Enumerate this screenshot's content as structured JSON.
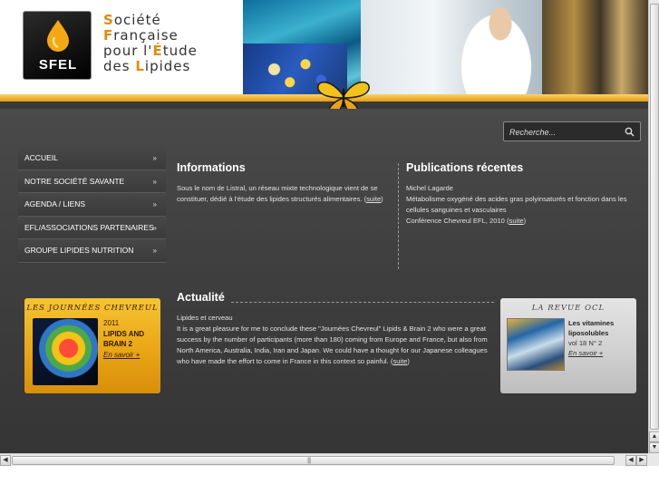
{
  "header": {
    "logo_text": "SFEL",
    "society_name_lines": [
      {
        "cap": "S",
        "rest": "ociété"
      },
      {
        "cap": "F",
        "rest": "rançaise"
      },
      {
        "pre": "pour l'",
        "cap": "É",
        "rest": "tude"
      },
      {
        "pre": "des ",
        "cap": "L",
        "rest": "ipides"
      }
    ]
  },
  "search": {
    "placeholder": "Recherche..."
  },
  "nav": {
    "items": [
      {
        "label": "ACCUEIL",
        "arrow": "»"
      },
      {
        "label": "NOTRE SOCIÉTÉ SAVANTE",
        "arrow": "»"
      },
      {
        "label": "AGENDA / LIENS",
        "arrow": "»"
      },
      {
        "label": "EFL/ASSOCIATIONS PARTENAIRES",
        "arrow": "»"
      },
      {
        "label": "GROUPE LIPIDES NUTRITION",
        "arrow": "»"
      }
    ]
  },
  "informations": {
    "title": "Informations",
    "text": "Sous le nom de Listral, un réseau mixte technologique vient de se constituer, dédié à l'étude des lipides structurés alimentaires. (",
    "link": "suite",
    "close": ")"
  },
  "publications": {
    "title": "Publications récentes",
    "author": "Michel Lagarde",
    "text": "Métabolisme oxygéné des acides gras polyinsaturés et fonction dans les cellules sanguines et vasculaires",
    "conference": "Conférence Chevreul EFL, 2010 (",
    "link": "suite",
    "close": ")"
  },
  "actualite": {
    "title": "Actualité",
    "subtitle": "Lipides et cerveau",
    "text": "It is a great pleasure for me to conclude these \"Journées Chevreul\" Lipids & Brain 2 who were a great success by the number of participants (more than 180) coming from Europe and France, but also from North America, Australia, India, Iran and Japan. We could have a thought for our Japanese colleagues who have made the effort to come in France in this context so painful. (",
    "link": "suite",
    "close": ")"
  },
  "chevreul": {
    "title": "LES JOURNÉES CHEVREUL",
    "year": "2011",
    "name": "LIPIDS AND BRAIN 2",
    "more": "En savoir +"
  },
  "ocl": {
    "title": "LA REVUE OCL",
    "headline": "Les vitamines liposolubles",
    "volume": "vol 18 N° 2",
    "more": "En savoir +"
  },
  "colors": {
    "accent_orange": "#e9a11a",
    "dark_bg": "#3f3f3f",
    "card_yellow": "#f5c433",
    "card_grey": "#d4d4d4"
  },
  "icons": {
    "search": "search-icon",
    "nav_arrow": "double-chevron-right-icon",
    "butterfly": "butterfly-icon",
    "logo_drop": "oil-drop-icon"
  }
}
